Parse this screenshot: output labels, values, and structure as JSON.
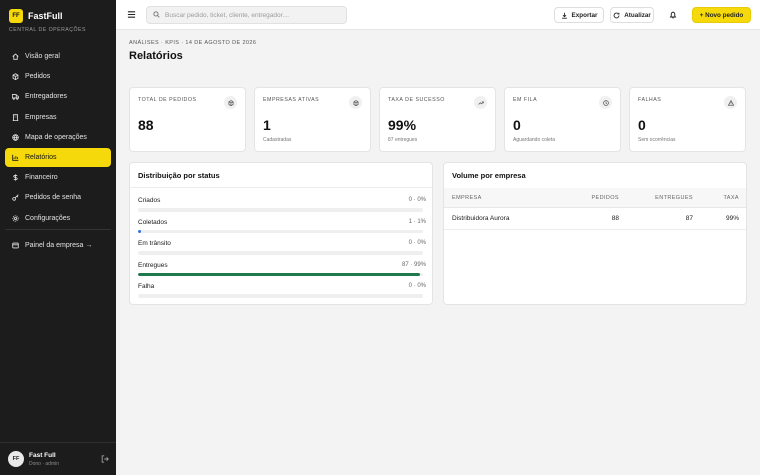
{
  "brand": {
    "logo": "FF",
    "name": "FastFull",
    "subtitle": "CENTRAL DE OPERAÇÕES",
    "accent": "#f5d90a"
  },
  "sidebar": {
    "items": [
      {
        "label": "Visão geral",
        "icon": "home-icon",
        "active": false
      },
      {
        "label": "Pedidos",
        "icon": "box-icon",
        "active": false
      },
      {
        "label": "Entregadores",
        "icon": "truck-icon",
        "active": false
      },
      {
        "label": "Empresas",
        "icon": "building-icon",
        "active": false
      },
      {
        "label": "Mapa de operações",
        "icon": "map-icon",
        "active": false
      },
      {
        "label": "Relatórios",
        "icon": "chart-icon",
        "active": true
      },
      {
        "label": "Financeiro",
        "icon": "dollar-icon",
        "active": false
      },
      {
        "label": "Pedidos de senha",
        "icon": "key-icon",
        "active": false
      },
      {
        "label": "Configurações",
        "icon": "gear-icon",
        "active": false
      }
    ],
    "company_panel": "Painel da empresa →"
  },
  "user": {
    "initials": "FF",
    "name": "Fast Full",
    "role": "Dono · admin"
  },
  "topbar": {
    "search_placeholder": "Buscar pedido, ticket, cliente, entregador…",
    "export_label": "Exportar",
    "refresh_label": "Atualizar",
    "new_order_label": "+ Novo pedido"
  },
  "page": {
    "breadcrumb": "ANÁLISES · KPIS · 14 DE AGOSTO DE 2026",
    "title": "Relatórios"
  },
  "kpis": [
    {
      "label": "TOTAL DE PEDIDOS",
      "value": "88",
      "sub": "",
      "icon": "box-icon"
    },
    {
      "label": "EMPRESAS ATIVAS",
      "value": "1",
      "sub": "Cadastradas",
      "icon": "building-icon"
    },
    {
      "label": "TAXA DE SUCESSO",
      "value": "99%",
      "sub": "87 entregues",
      "icon": "trend-up-icon"
    },
    {
      "label": "EM FILA",
      "value": "0",
      "sub": "Aguardando coleta",
      "icon": "clock-icon"
    },
    {
      "label": "FALHAS",
      "value": "0",
      "sub": "Sem ocorrências",
      "icon": "alert-icon"
    }
  ],
  "status_panel": {
    "title": "Distribuição por status",
    "rows": [
      {
        "name": "Criados",
        "value": "0 · 0%",
        "fraction": 0.0,
        "color": "#2b6fe0"
      },
      {
        "name": "Coletados",
        "value": "1 · 1%",
        "fraction": 0.012,
        "color": "#2b6fe0"
      },
      {
        "name": "Em trânsito",
        "value": "0 · 0%",
        "fraction": 0.0,
        "color": "#2b6fe0"
      },
      {
        "name": "Entregues",
        "value": "87 · 99%",
        "fraction": 0.99,
        "color": "#1e7a4c"
      },
      {
        "name": "Falha",
        "value": "0 · 0%",
        "fraction": 0.0,
        "color": "#d13a3a"
      }
    ]
  },
  "volume_panel": {
    "title": "Volume por empresa",
    "headers": [
      "EMPRESA",
      "PEDIDOS",
      "ENTREGUES",
      "TAXA"
    ],
    "rows": [
      {
        "empresa": "Distribuidora Aurora",
        "pedidos": "88",
        "entregues": "87",
        "taxa": "99%"
      }
    ]
  }
}
